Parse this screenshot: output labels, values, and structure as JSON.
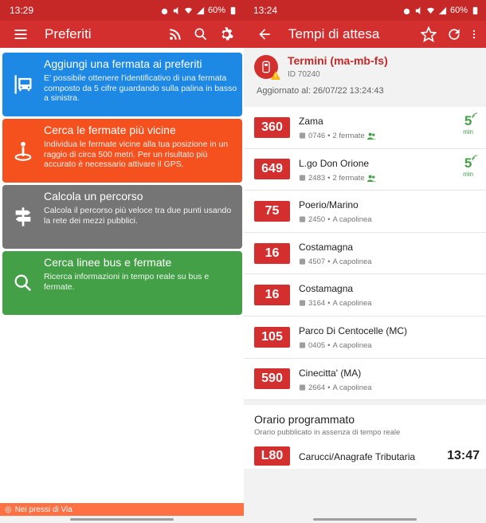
{
  "left": {
    "status": {
      "time": "13:29",
      "battery": "60%"
    },
    "appbar": {
      "title": "Preferiti"
    },
    "cards": [
      {
        "title": "Aggiungi una fermata ai preferiti",
        "desc": "E' possibile ottenere l'identificativo di una fermata composto da 5 cifre guardando sulla palina in basso a sinistra.",
        "color": "#1e88e5",
        "icon": "bus-stop-icon"
      },
      {
        "title": "Cerca le fermate più vicine",
        "desc": "Individua le fermate vicine alla tua posizione in un raggio di circa 500 metri. Per un risultato più accurato è necessario attivare il GPS.",
        "color": "#f4511e",
        "icon": "location-pin-icon"
      },
      {
        "title": "Calcola un percorso",
        "desc": "Calcola il percorso più veloce tra due punti usando la rete dei mezzi pubblici.",
        "color": "#757575",
        "icon": "signpost-icon"
      },
      {
        "title": "Cerca linee bus e fermate",
        "desc": "Ricerca informazioni in tempo reale su bus e fermate.",
        "color": "#43a047",
        "icon": "search-icon"
      }
    ],
    "nearby_label": "Nei pressi di Via"
  },
  "right": {
    "status": {
      "time": "13:24",
      "battery": "60%"
    },
    "appbar": {
      "title": "Tempi di attesa"
    },
    "stop": {
      "name": "Termini (ma-mb-fs)",
      "id": "ID 70240",
      "updated": "Aggiornato al: 26/07/22 13:24:43"
    },
    "arrivals": [
      {
        "line": "360",
        "dest": "Zama",
        "code": "0746",
        "info": "2 fermate",
        "eta": "5",
        "unit": "min",
        "realtime": true
      },
      {
        "line": "649",
        "dest": "L.go Don Orione",
        "code": "2483",
        "info": "2 fermate",
        "eta": "5",
        "unit": "min",
        "realtime": true
      },
      {
        "line": "75",
        "dest": "Poerio/Marino",
        "code": "2450",
        "info": "A capolinea",
        "eta": "",
        "unit": "",
        "realtime": false
      },
      {
        "line": "16",
        "dest": "Costamagna",
        "code": "4507",
        "info": "A capolinea",
        "eta": "",
        "unit": "",
        "realtime": false
      },
      {
        "line": "16",
        "dest": "Costamagna",
        "code": "3164",
        "info": "A capolinea",
        "eta": "",
        "unit": "",
        "realtime": false
      },
      {
        "line": "105",
        "dest": "Parco Di Centocelle (MC)",
        "code": "0405",
        "info": "A capolinea",
        "eta": "",
        "unit": "",
        "realtime": false
      },
      {
        "line": "590",
        "dest": "Cinecitta' (MA)",
        "code": "2664",
        "info": "A capolinea",
        "eta": "",
        "unit": "",
        "realtime": false
      }
    ],
    "scheduled": {
      "title": "Orario programmato",
      "subtitle": "Orario pubblicato in assenza di tempo reale",
      "row": {
        "line": "L80",
        "dest": "Carucci/Anagrafe Tributaria",
        "time": "13:47"
      }
    }
  },
  "colors": {
    "red": "#d32f2f",
    "green": "#43a047",
    "orange": "#ff7043"
  }
}
